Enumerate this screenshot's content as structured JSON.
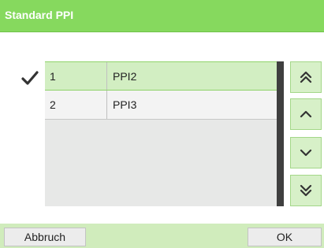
{
  "title": "Standard PPI",
  "list": {
    "rows": [
      {
        "number": "1",
        "name": "PPI2",
        "selected": true
      },
      {
        "number": "2",
        "name": "PPI3",
        "selected": false
      }
    ]
  },
  "nav": {
    "first_icon": "double-chevron-up-icon",
    "up_icon": "chevron-up-icon",
    "down_icon": "chevron-down-icon",
    "last_icon": "double-chevron-down-icon"
  },
  "footer": {
    "cancel_label": "Abbruch",
    "ok_label": "OK"
  },
  "colors": {
    "header": "#86d95e",
    "selected_row": "#d2eec2",
    "footer": "#d0ecbc",
    "scrollbar": "#3f3f3f"
  }
}
